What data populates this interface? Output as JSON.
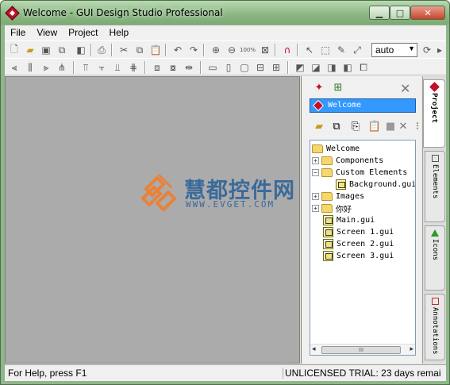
{
  "window": {
    "title": "Welcome - GUI Design Studio Professional",
    "controls": {
      "minimize": "▁",
      "maximize": "□",
      "close": "✕"
    }
  },
  "menu": [
    "File",
    "View",
    "Project",
    "Help"
  ],
  "toolbar": {
    "zoom_value": "auto",
    "zoom_100_label": "100%"
  },
  "watermark": {
    "title": "慧都控件网",
    "url": "WWW.EVGET.COM"
  },
  "panel": {
    "project_name": "Welcome",
    "tree": [
      {
        "label": "Welcome",
        "type": "folder"
      },
      {
        "label": "Components",
        "type": "folder"
      },
      {
        "label": "Custom Elements",
        "type": "folder"
      },
      {
        "label": "Background.gui",
        "type": "file"
      },
      {
        "label": "Images",
        "type": "folder"
      },
      {
        "label": "你好",
        "type": "folder"
      },
      {
        "label": "Main.gui",
        "type": "file"
      },
      {
        "label": "Screen 1.gui",
        "type": "file"
      },
      {
        "label": "Screen 2.gui",
        "type": "file"
      },
      {
        "label": "Screen 3.gui",
        "type": "file"
      }
    ],
    "scroll_grip": "III"
  },
  "side_tabs": [
    "Project",
    "Elements",
    "Icons",
    "Annotations"
  ],
  "status": {
    "left": "For Help, press F1",
    "right": "UNLICENSED TRIAL: 23 days remai"
  },
  "colors": {
    "title_bar": "#8db885",
    "selection": "#3399ff",
    "canvas": "#ababab",
    "brand_red": "#c0102a"
  }
}
